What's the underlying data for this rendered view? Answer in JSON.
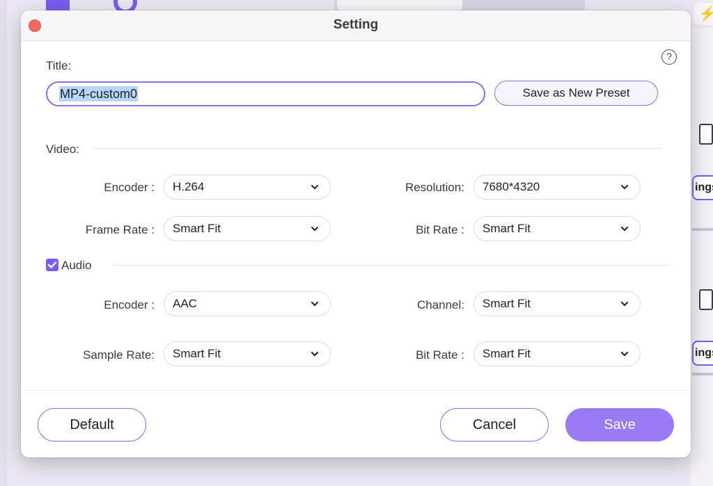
{
  "dialog": {
    "title": "Setting",
    "help_icon": "?"
  },
  "title_field": {
    "label": "Title:",
    "value": "MP4-custom0"
  },
  "save_preset_label": "Save as New Preset",
  "video": {
    "section_label": "Video:",
    "encoder": {
      "label": "Encoder :",
      "value": "H.264"
    },
    "resolution": {
      "label": "Resolution:",
      "value": "7680*4320"
    },
    "frame_rate": {
      "label": "Frame Rate :",
      "value": "Smart Fit"
    },
    "bit_rate": {
      "label": "Bit Rate :",
      "value": "Smart Fit"
    }
  },
  "audio": {
    "section_label": "Audio",
    "enabled": true,
    "encoder": {
      "label": "Encoder :",
      "value": "AAC"
    },
    "channel": {
      "label": "Channel:",
      "value": "Smart Fit"
    },
    "sample_rate": {
      "label": "Sample Rate:",
      "value": "Smart Fit"
    },
    "bit_rate": {
      "label": "Bit Rate :",
      "value": "Smart Fit"
    }
  },
  "footer": {
    "default_label": "Default",
    "cancel_label": "Cancel",
    "save_label": "Save"
  },
  "background": {
    "settings_button_fragment": "ings"
  },
  "colors": {
    "accent": "#7b5cf0",
    "primary_button": "#9a7bf5",
    "close_dot": "#ee6a5e"
  }
}
